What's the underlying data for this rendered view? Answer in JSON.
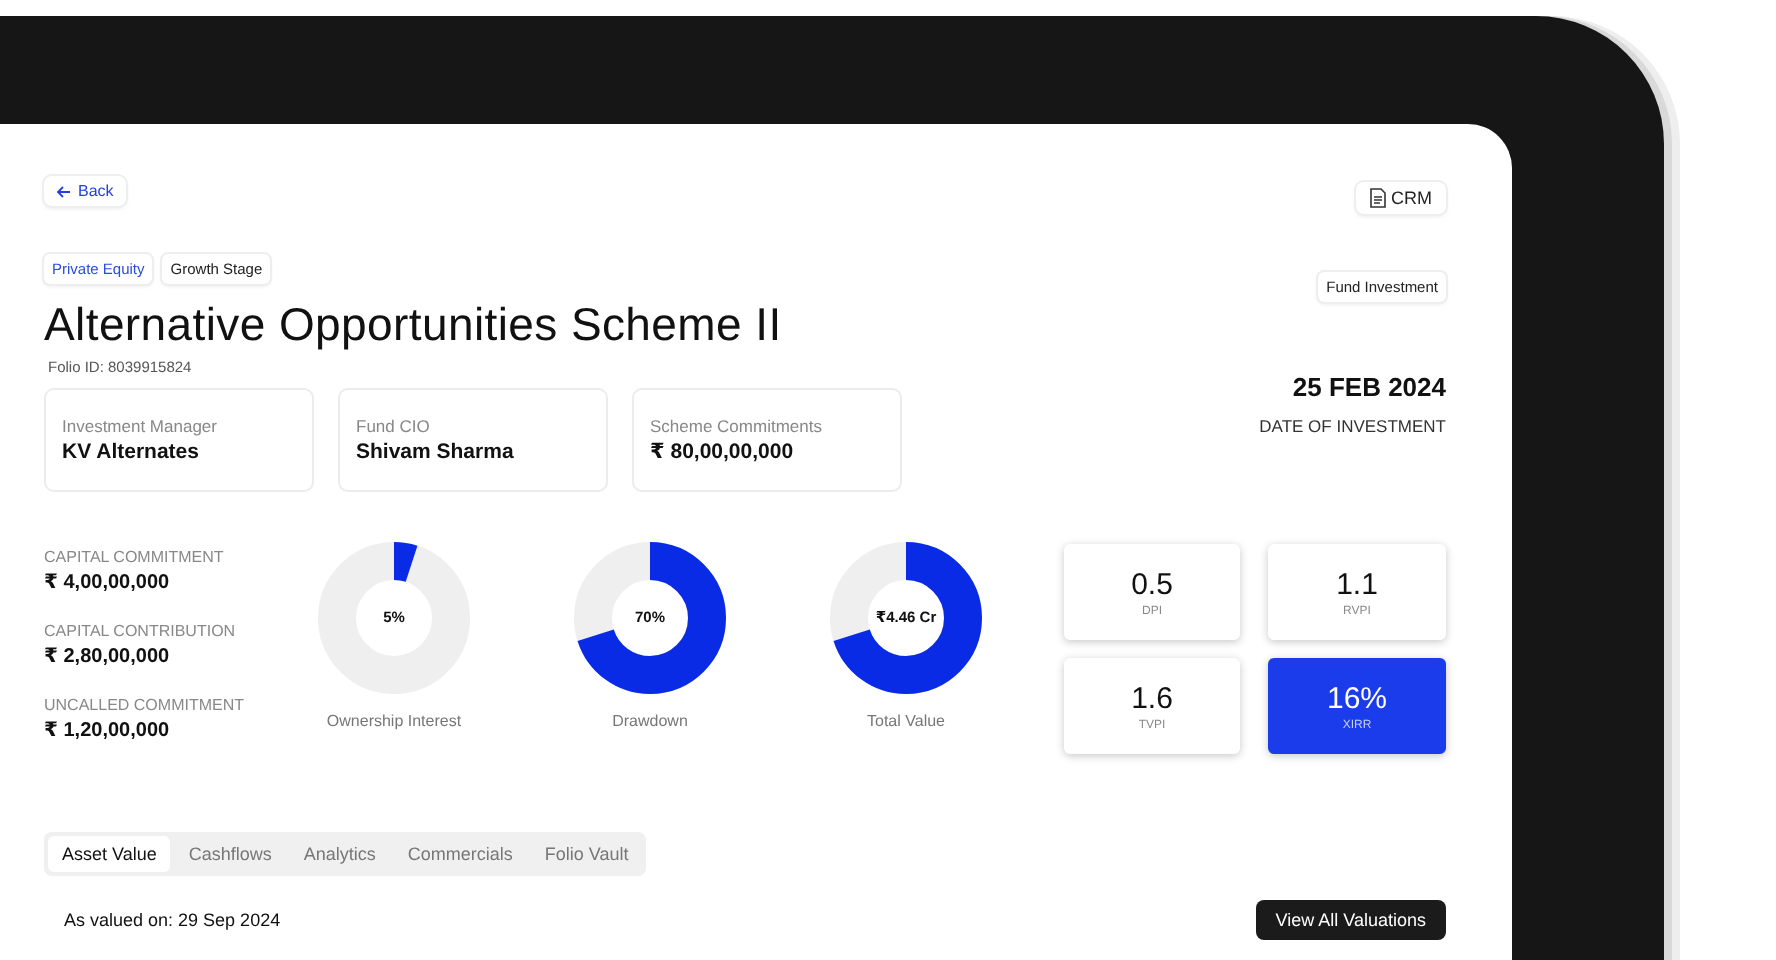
{
  "back_button": {
    "label": "Back"
  },
  "crm_button": {
    "label": "CRM"
  },
  "tags": [
    {
      "label": "Private Equity",
      "kind": "accent"
    },
    {
      "label": "Growth Stage",
      "kind": "plain"
    }
  ],
  "title": "Alternative Opportunities Scheme II",
  "folio_id": "Folio ID: 8039915824",
  "type_tag": "Fund Investment",
  "info_cards": [
    {
      "label": "Investment Manager",
      "value": "KV Alternates"
    },
    {
      "label": "Fund CIO",
      "value": "Shivam Sharma"
    },
    {
      "label": "Scheme Commitments",
      "value": "₹ 80,00,00,000"
    }
  ],
  "investment_date": {
    "value": "25 FEB 2024",
    "label": "DATE OF INVESTMENT"
  },
  "capital": [
    {
      "label": "CAPITAL COMMITMENT",
      "value": "₹ 4,00,00,000"
    },
    {
      "label": "CAPITAL CONTRIBUTION",
      "value": "₹ 2,80,00,000"
    },
    {
      "label": "UNCALLED COMMITMENT",
      "value": "₹ 1,20,00,000"
    }
  ],
  "donuts": [
    {
      "center": "5%",
      "label": "Ownership Interest",
      "level": 0.05
    },
    {
      "center": "70%",
      "label": "Drawdown",
      "level": 0.7
    },
    {
      "center": "₹4.46 Cr",
      "label": "Total Value",
      "level": 0.7
    }
  ],
  "metrics": [
    {
      "value": "0.5",
      "label": "DPI",
      "highlighted": false
    },
    {
      "value": "1.1",
      "label": "RVPI",
      "highlighted": false
    },
    {
      "value": "1.6",
      "label": "TVPI",
      "highlighted": false
    },
    {
      "value": "16%",
      "label": "XIRR",
      "highlighted": true
    }
  ],
  "tabs": [
    {
      "label": "Asset Value",
      "selected": true
    },
    {
      "label": "Cashflows",
      "selected": false
    },
    {
      "label": "Analytics",
      "selected": false
    },
    {
      "label": "Commercials",
      "selected": false
    },
    {
      "label": "Folio Vault",
      "selected": false
    }
  ],
  "valued_on": "As valued on: 29 Sep 2024",
  "valuations_button": {
    "label": "View All Valuations"
  }
}
